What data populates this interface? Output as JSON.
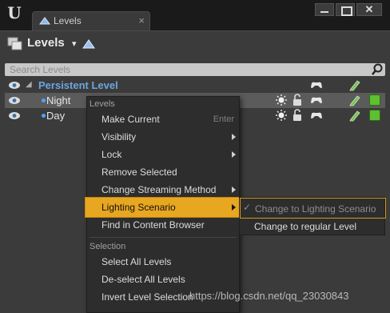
{
  "window": {
    "tab_label": "Levels",
    "tab_close": "×",
    "logo_glyph": "U",
    "close_glyph": "✕"
  },
  "panel": {
    "title": "Levels",
    "dropdown_glyph": "▾",
    "search_placeholder": "Search Levels"
  },
  "levels": {
    "persistent": {
      "label": "Persistent Level",
      "expander": "◢"
    },
    "rows": [
      {
        "label": "Night",
        "selected": true
      },
      {
        "label": "Day",
        "selected": false
      }
    ]
  },
  "icons": {
    "eye": "eye-icon",
    "lightbulb": "light-icon",
    "lock": "lock-icon",
    "controller": "gamepad-icon",
    "pencil": "color-pencil-icon",
    "status": "status-square-icon"
  },
  "colors": {
    "accent_highlight": "#e8a720",
    "persistent_text": "#6aa6df",
    "status_green": "#5dc02f",
    "pencil_green": "#77c25a"
  },
  "menu": {
    "section_levels": "Levels",
    "section_selection": "Selection",
    "items": {
      "make_current": "Make Current",
      "make_current_shortcut": "Enter",
      "visibility": "Visibility",
      "lock": "Lock",
      "remove_selected": "Remove Selected",
      "change_streaming": "Change Streaming Method",
      "lighting_scenario": "Lighting Scenario",
      "find_content": "Find in Content Browser",
      "select_all": "Select All Levels",
      "deselect_all": "De-select All Levels",
      "invert_selection": "Invert Level Selection"
    }
  },
  "submenu": {
    "check_glyph": "✓",
    "change_to_scenario": "Change to Lighting Scenario",
    "change_to_regular": "Change to regular Level"
  },
  "watermark": "https://blog.csdn.net/qq_23030843"
}
